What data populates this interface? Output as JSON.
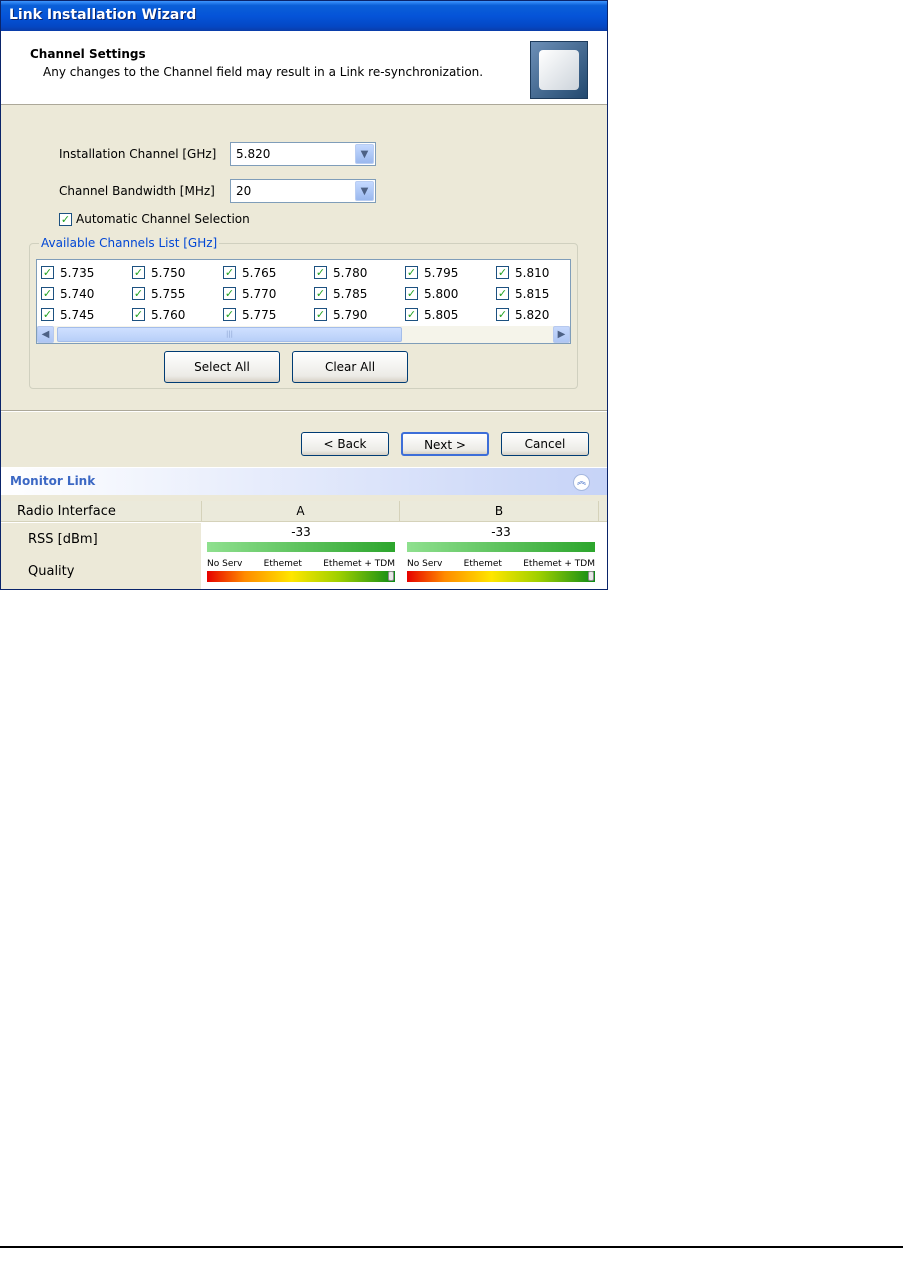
{
  "window": {
    "title": "Link Installation Wizard"
  },
  "header": {
    "title": "Channel Settings",
    "subtitle": "Any changes to the Channel field may result in a Link re-synchronization.",
    "icon": "antenna-panel-icon"
  },
  "form": {
    "installation_channel": {
      "label": "Installation Channel [GHz]",
      "value": "5.820"
    },
    "channel_bandwidth": {
      "label": "Channel Bandwidth [MHz]",
      "value": "20"
    },
    "automatic_selection": {
      "label": "Automatic Channel Selection",
      "checked": true
    }
  },
  "channels": {
    "legend": "Available Channels List [GHz]",
    "items": [
      "5.735",
      "5.750",
      "5.765",
      "5.780",
      "5.795",
      "5.810",
      "5.740",
      "5.755",
      "5.770",
      "5.785",
      "5.800",
      "5.815",
      "5.745",
      "5.760",
      "5.775",
      "5.790",
      "5.805",
      "5.820"
    ],
    "select_all": "Select All",
    "clear_all": "Clear All"
  },
  "nav": {
    "back": "< Back",
    "next": "Next >",
    "cancel": "Cancel"
  },
  "monitor": {
    "title": "Monitor Link",
    "columns": [
      "Radio Interface",
      "A",
      "B"
    ],
    "rss_label": "RSS [dBm]",
    "quality_label": "Quality",
    "rss": {
      "A": "-33",
      "B": "-33"
    },
    "quality_scale": [
      "No Serv",
      "Ethemet",
      "Ethemet + TDM"
    ]
  },
  "colors": {
    "title_bar": "#0554d8",
    "window_bg": "#ece9d8",
    "group_legend": "#0046d5",
    "monitor_title": "#3c68c4"
  }
}
